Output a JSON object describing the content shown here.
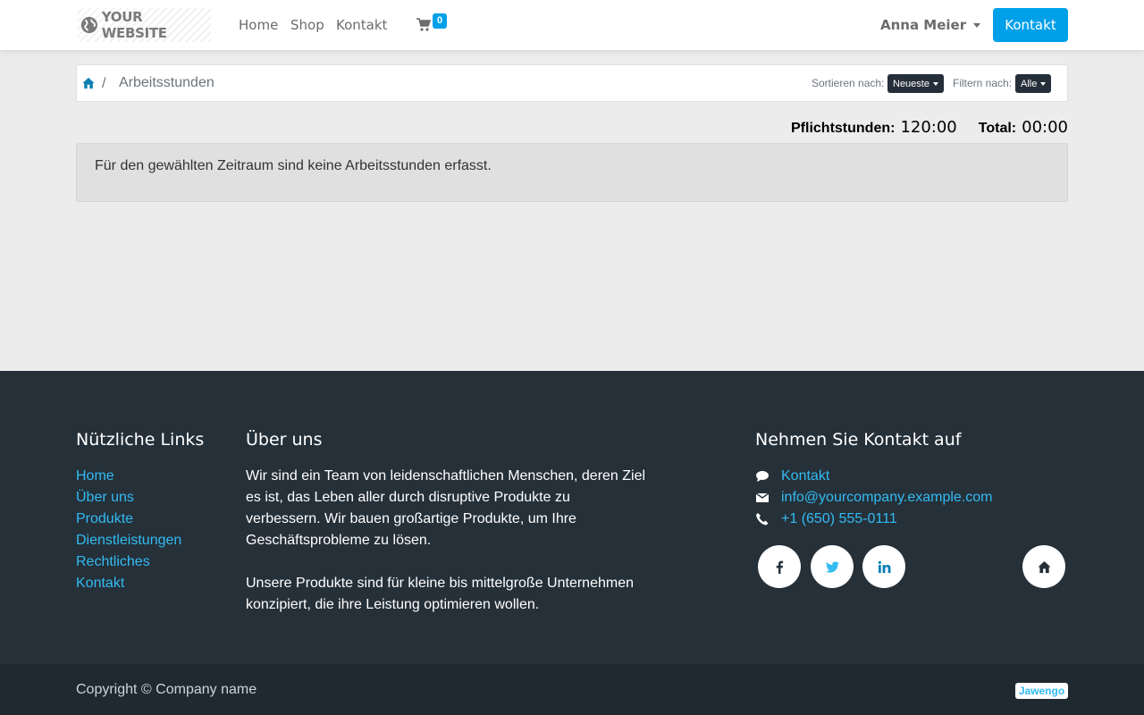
{
  "header": {
    "brand": "YOUR WEBSITE",
    "nav": [
      "Home",
      "Shop",
      "Kontakt"
    ],
    "cart_count": "0",
    "user_name": "Anna Meier",
    "contact_button": "Kontakt"
  },
  "breadcrumb": {
    "current": "Arbeitsstunden",
    "separator": "/"
  },
  "sort": {
    "label": "Sortieren nach:",
    "value": "Neueste"
  },
  "filter": {
    "label": "Filtern nach:",
    "value": "Alle"
  },
  "totals": {
    "required_label": "Pflichtstunden:",
    "required_value": "120:00",
    "total_label": "Total:",
    "total_value": "00:00"
  },
  "info_message": "Für den gewählten Zeitraum sind keine Arbeitsstunden erfasst.",
  "footer": {
    "links_title": "Nützliche Links",
    "links": [
      "Home",
      "Über uns",
      "Produkte",
      "Dienstleistungen",
      "Rechtliches",
      "Kontakt"
    ],
    "about_title": "Über uns",
    "about_p1": "Wir sind ein Team von leidenschaftlichen Menschen, deren Ziel es ist, das Leben aller durch disruptive Produkte zu verbessern. Wir bauen großartige Produkte, um Ihre Geschäftsprobleme zu lösen.",
    "about_p2": "Unsere Produkte sind für kleine bis mittelgroße Unternehmen konzipiert, die ihre Leistung optimieren wollen.",
    "contact_title": "Nehmen Sie Kontakt auf",
    "contact_link": "Kontakt",
    "email": "info@yourcompany.example.com",
    "phone": "+1 (650) 555-0111",
    "social_icons": [
      "facebook-icon",
      "twitter-icon",
      "linkedin-icon",
      "home-icon"
    ]
  },
  "copyright": {
    "text": "Copyright © Company name",
    "badge": "Jawengo"
  },
  "colors": {
    "accent": "#00a0e9",
    "link": "#33bbf2",
    "footer_bg": "#253039",
    "copy_bg": "#1f2930",
    "dropdown_bg": "#252f3a"
  }
}
